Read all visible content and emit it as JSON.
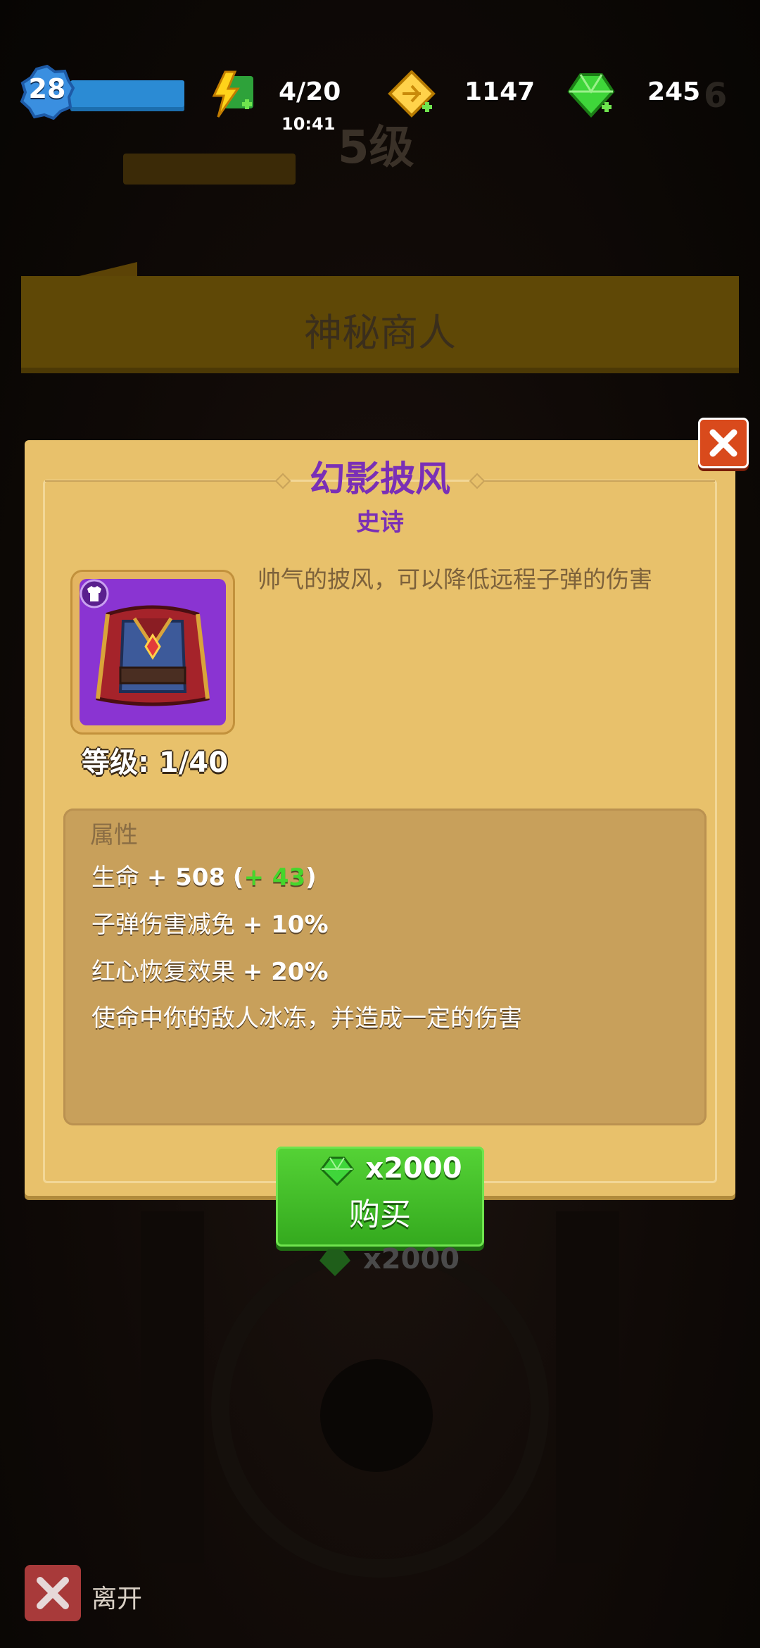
{
  "hud": {
    "player_level": "28",
    "energy": "4/20",
    "energy_timer": "10:41",
    "gold": "1147",
    "gems": "245",
    "icons": [
      "energy-icon",
      "gold-icon",
      "gem-icon"
    ]
  },
  "background": {
    "dim_level": "5级",
    "dim_side_number": "6"
  },
  "merchant": {
    "title": "神秘商人"
  },
  "item": {
    "name": "幻影披风",
    "rarity": "史诗",
    "description": "帅气的披风，可以降低远程子弹的伤害",
    "level_text": "等级: 1/40",
    "type_icon": "armor-icon"
  },
  "stats": {
    "header": "属性",
    "lines": [
      {
        "label": "生命",
        "value": "+ 508",
        "bonus_open": "(",
        "bonus": "+ 43",
        "bonus_close": ")"
      },
      {
        "label": "子弹伤害减免",
        "value": "+ 10%"
      },
      {
        "label": "红心恢复效果",
        "value": "+ 20%"
      },
      {
        "label": "使命中你的敌人冰冻，并造成一定的伤害"
      }
    ]
  },
  "buy": {
    "price": "x2000",
    "label": "购买"
  },
  "behind_price": "x2000",
  "leave": {
    "label": "离开"
  },
  "colors": {
    "epic": "#7a2fb6",
    "panel": "#e8c16b",
    "buy_green": "#3fbf24",
    "bonus_green": "#46d62c"
  }
}
